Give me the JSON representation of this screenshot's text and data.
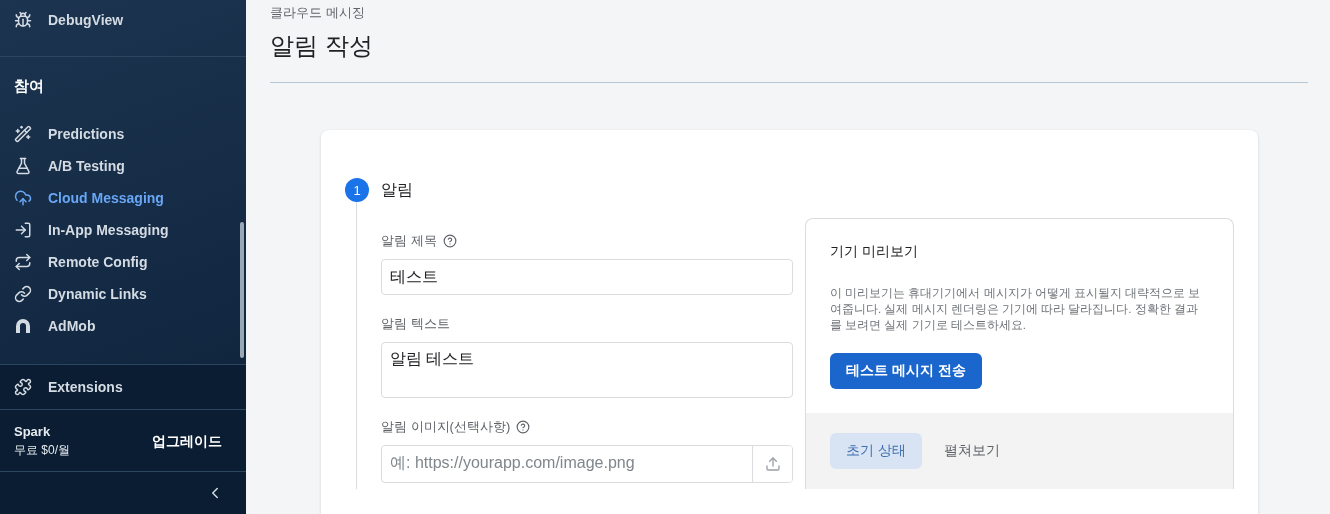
{
  "sidebar": {
    "top_item": {
      "label": "DebugView"
    },
    "section_title": "참여",
    "items": [
      {
        "label": "Predictions",
        "selected": false
      },
      {
        "label": "A/B Testing",
        "selected": false
      },
      {
        "label": "Cloud Messaging",
        "selected": true
      },
      {
        "label": "In-App Messaging",
        "selected": false
      },
      {
        "label": "Remote Config",
        "selected": false
      },
      {
        "label": "Dynamic Links",
        "selected": false
      },
      {
        "label": "AdMob",
        "selected": false
      }
    ],
    "extensions": {
      "label": "Extensions"
    },
    "plan": {
      "name": "Spark",
      "price": "무료 $0/월",
      "upgrade": "업그레이드"
    }
  },
  "header": {
    "breadcrumb": "클라우드 메시징",
    "title": "알림 작성"
  },
  "step": {
    "number": "1",
    "title": "알림",
    "fields": [
      {
        "kind": "input",
        "label": "알림 제목",
        "help": true,
        "value": "테스트"
      },
      {
        "kind": "textarea",
        "label": "알림 텍스트",
        "help": false,
        "value": "알림 테스트"
      },
      {
        "kind": "upload",
        "label": "알림 이미지(선택사항)",
        "help": true,
        "placeholder": "예: https://yourapp.com/image.png"
      }
    ]
  },
  "preview": {
    "title": "기기 미리보기",
    "description": "이 미리보기는 휴대기기에서 메시지가 어떻게 표시될지 대략적으로 보여줍니다. 실제 메시지 렌더링은 기기에 따라 달라집니다. 정확한 결과를 보려면 실제 기기로 테스트하세요.",
    "button": "테스트 메시지 전송",
    "tabs": [
      {
        "label": "초기 상태",
        "selected": true
      },
      {
        "label": "펼쳐보기",
        "selected": false
      }
    ]
  }
}
